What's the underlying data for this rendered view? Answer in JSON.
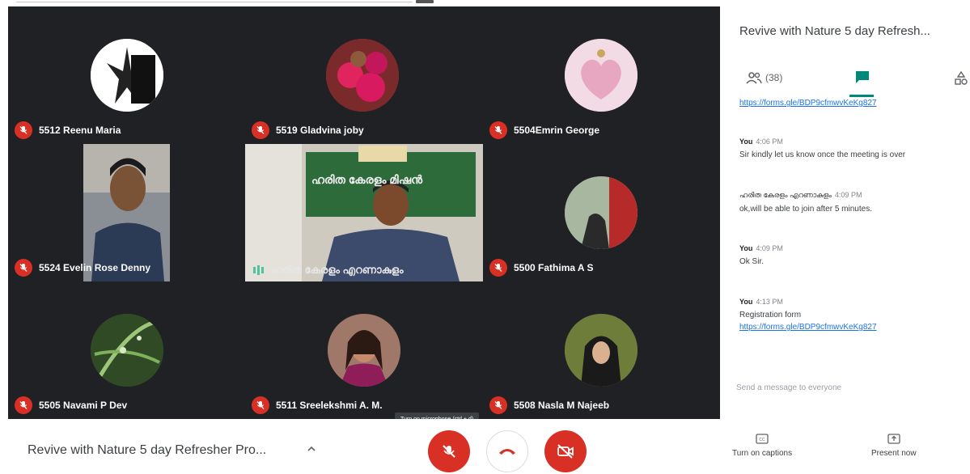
{
  "participants": [
    {
      "name": "5512 Reenu Maria"
    },
    {
      "name": "5519 Gladvina joby"
    },
    {
      "name": "5504Emrin George"
    },
    {
      "name": "5524 Evelin Rose Denny"
    },
    {
      "name": "5500 Fathima A S"
    },
    {
      "name": "5505 Navami P Dev"
    },
    {
      "name": "5511 Sreelekshmi A. M."
    },
    {
      "name": "5508 Nasla M Najeeb"
    }
  ],
  "presenter": {
    "name": "ഹരിത കേരളം എറണാകുളം",
    "banner": "ഹരിത കേരളം മിഷൻ"
  },
  "tooltip": "Turn on microphone (ctrl + d)",
  "panel": {
    "title": "Revive with Nature 5 day Refresh...",
    "people_count": "(38)",
    "top_link": "https://forms.gle/BDP9cfmwvKeKg827",
    "messages": [
      {
        "sender": "You",
        "time": "4:06 PM",
        "text": "Sir kindly let us know once the meeting is over"
      },
      {
        "sender": "ഹരിത കേരളം എറണാകുളം",
        "time": "4:09 PM",
        "text": "ok,will be able to join after 5 minutes."
      },
      {
        "sender": "You",
        "time": "4:09 PM",
        "text": "Ok Sir."
      },
      {
        "sender": "You",
        "time": "4:13 PM",
        "text": "Registration form",
        "link": "https://forms.gle/BDP9cfmwvKeKg827"
      }
    ],
    "input_placeholder": "Send a message to everyone"
  },
  "bottom_bar": {
    "meeting_title": "Revive with Nature 5 day Refresher Pro...",
    "captions_label": "Turn on captions",
    "present_label": "Present now"
  },
  "colors": {
    "stage": "#202124",
    "muted_red": "#d93025",
    "chat_accent": "#00897b",
    "link_blue": "#1a73e8"
  },
  "icons": [
    "mic-off-icon",
    "people-icon",
    "chat-icon",
    "activities-icon",
    "chevron-up-icon",
    "hang-up-icon",
    "camera-off-icon",
    "captions-icon",
    "present-icon",
    "audio-indicator-icon"
  ]
}
